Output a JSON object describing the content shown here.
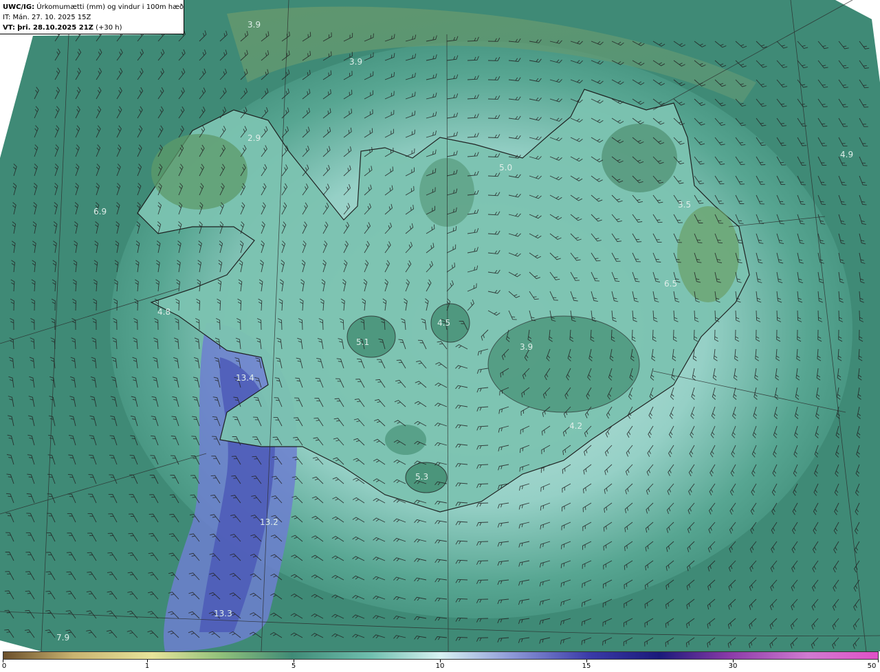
{
  "header": {
    "product": "UWC/IG:",
    "title": "Úrkomumætti (mm) og vindur i 100m hæð",
    "init_time": "IT: Mán. 27. 10. 2025 15Z",
    "valid_prefix": "VT:",
    "valid_time": "þri. 28.10.2025 21Z",
    "lead": "(+30 h)"
  },
  "map": {
    "background_color": "#3f8a76",
    "coast_color": "#111111",
    "barb_color": "#222222",
    "value_labels": [
      "3.9",
      "3.9",
      "2.9",
      "5.0",
      "4.9",
      "3.5",
      "6.9",
      "6.5",
      "4.8",
      "4.5",
      "5.1",
      "3.9",
      "13.4",
      "4.2",
      "5.3",
      "13.2",
      "13.3",
      "7.9"
    ]
  },
  "colorbar": {
    "ticks": [
      "0",
      "1",
      "5",
      "10",
      "15",
      "30",
      "50"
    ],
    "colors": [
      "#6b4f2a",
      "#c9b370",
      "#e8e49a",
      "#8fc07a",
      "#3f8a76",
      "#6fbfae",
      "#d8f2f2",
      "#8e9ad8",
      "#3a3aa8",
      "#1a1a7a",
      "#8a3aa8",
      "#d07ad0",
      "#e050c8"
    ]
  }
}
